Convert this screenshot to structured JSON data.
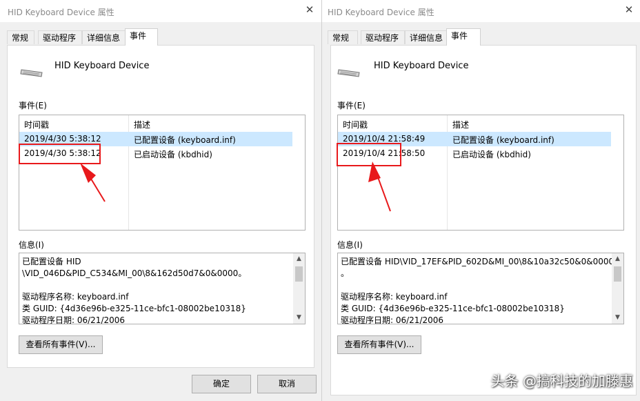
{
  "left": {
    "title": "HID Keyboard Device 属性",
    "tabs": [
      "常规",
      "驱动程序",
      "详细信息",
      "事件"
    ],
    "device_name": "HID Keyboard Device",
    "events_label": "事件(E)",
    "columns": [
      "时间戳",
      "描述"
    ],
    "events": [
      {
        "time": "2019/4/30 5:38:12",
        "desc": "已配置设备 (keyboard.inf)"
      },
      {
        "time": "2019/4/30 5:38:12",
        "desc": "已启动设备 (kbdhid)"
      }
    ],
    "info_label": "信息(I)",
    "info_text": "已配置设备 HID\n\\VID_046D&PID_C534&MI_00\\8&162d50d7&0&0000。\n\n驱动程序名称: keyboard.inf\n类 GUID: {4d36e96b-e325-11ce-bfc1-08002be10318}\n驱动程序日期: 06/21/2006",
    "view_all_button": "查看所有事件(V)...",
    "ok_button": "确定",
    "cancel_button": "取消"
  },
  "right": {
    "title": "HID Keyboard Device 属性",
    "tabs": [
      "常规",
      "驱动程序",
      "详细信息",
      "事件"
    ],
    "device_name": "HID Keyboard Device",
    "events_label": "事件(E)",
    "columns": [
      "时间戳",
      "描述"
    ],
    "events": [
      {
        "time": "2019/10/4 21:58:49",
        "desc": "已配置设备 (keyboard.inf)"
      },
      {
        "time": "2019/10/4 21:58:50",
        "desc": "已启动设备 (kbdhid)"
      }
    ],
    "info_label": "信息(I)",
    "info_text": "已配置设备 HID\\VID_17EF&PID_602D&MI_00\\8&10a32c50&0&0000\n。\n\n驱动程序名称: keyboard.inf\n类 GUID: {4d36e96b-e325-11ce-bfc1-08002be10318}\n驱动程序日期: 06/21/2006",
    "view_all_button": "查看所有事件(V)..."
  },
  "watermark": "头条 @搞科技的加滕惠",
  "colors": {
    "highlight": "#e8191b",
    "selection": "#cce8ff"
  }
}
